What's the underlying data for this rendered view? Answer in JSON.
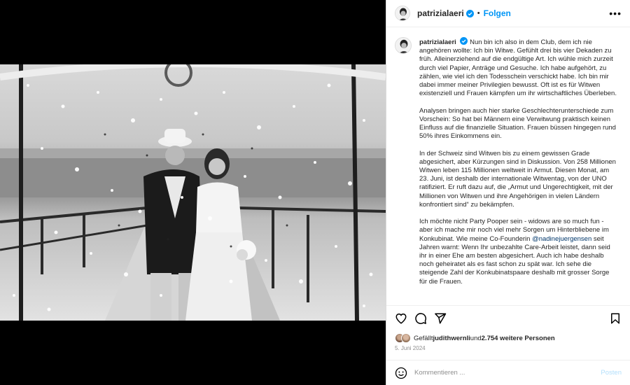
{
  "header": {
    "username": "patrizialaeri",
    "separator": "•",
    "follow_label": "Folgen",
    "more_label": "•••"
  },
  "caption": {
    "username": "patrizialaeri",
    "paragraphs": [
      "Nun bin ich also in dem Club, dem ich nie angehören wollte: Ich bin Witwe. Gefühlt drei bis vier Dekaden zu früh. Alleinerziehend auf die endgültige Art. Ich wühle mich zurzeit durch viel Papier, Anträge und Gesuche. Ich habe aufgehört, zu zählen, wie viel ich den Todesschein verschickt habe. Ich bin mir dabei immer meiner Privilegien bewusst. Oft ist es für Witwen existenziell und Frauen kämpfen um ihr wirtschaftliches Überleben.",
      "Analysen bringen auch hier starke Geschlechterunterschiede zum Vorschein: So hat bei Männern eine Verwitwung praktisch keinen Einfluss auf die finanzielle Situation. Frauen büssen hingegen rund 50% ihres Einkommens ein.",
      "In der Schweiz sind Witwen bis zu einem gewissen Grade abgesichert, aber Kürzungen sind in Diskussion. Von 258 Millionen Witwen leben 115 Millionen weltweit in Armut. Diesen Monat, am 23. Juni, ist deshalb der internationale Witwentag, von der UNO ratifiziert. Er ruft dazu auf, die „Armut und Ungerechtigkeit, mit der Millionen von Witwen und ihre Angehörigen in vielen Ländern konfrontiert sind“ zu bekämpfen."
    ],
    "last_before_mention": "Ich möchte nicht Party Pooper sein - widows are so much fun - aber ich mache mir noch viel mehr Sorgen um Hinterbliebene im Konkubinat. Wie meine Co-Founderin ",
    "mention": "@nadinejuergensen",
    "last_after_mention": " seit Jahren warnt: Wenn Ihr unbezahlte Care-Arbeit leistet, dann seid ihr in einer Ehe am besten abgesichert. Auch ich habe deshalb noch geheiratet als es fast schon zu spät war. Ich sehe die steigende Zahl der Konkubinatspaare deshalb mit grosser Sorge für die Frauen."
  },
  "actions": {
    "like_icon": "heart-icon",
    "comment_icon": "comment-icon",
    "share_icon": "send-icon",
    "save_icon": "bookmark-icon"
  },
  "likes": {
    "prefix": "Gefällt ",
    "user": "judithwernli",
    "middle": " und ",
    "count": "2.754 weitere Personen"
  },
  "date": "5. Juni 2024",
  "comment": {
    "emoji_icon": "smiley-icon",
    "placeholder": "Kommentieren ...",
    "post_label": "Posten"
  },
  "colors": {
    "accent": "#0095f6",
    "mention": "#00376b",
    "verified": "#0095f6",
    "muted": "#8e8e8e"
  }
}
